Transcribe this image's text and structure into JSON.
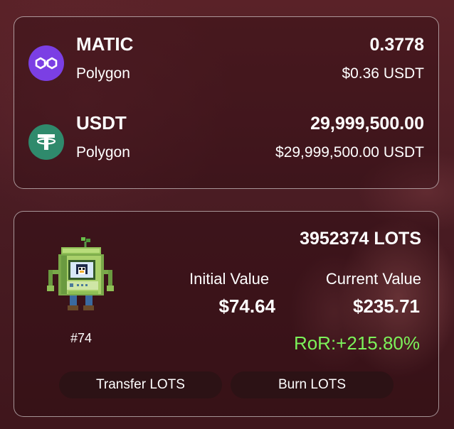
{
  "tokens": [
    {
      "symbol": "MATIC",
      "network": "Polygon",
      "balance": "0.3778",
      "usd": "$0.36 USDT",
      "icon": "polygon-icon",
      "color": "#7b3fe4"
    },
    {
      "symbol": "USDT",
      "network": "Polygon",
      "balance": "29,999,500.00",
      "usd": "$29,999,500.00 USDT",
      "icon": "tether-icon",
      "color": "#2f8a6c"
    }
  ],
  "nft": {
    "id": "#74",
    "amount": "3952374 LOTS",
    "initial_label": "Initial Value",
    "initial_value": "$74.64",
    "current_label": "Current Value",
    "current_value": "$235.71",
    "ror": "RoR:+215.80%",
    "ror_color": "#7cf25a"
  },
  "actions": {
    "transfer_label": "Transfer LOTS",
    "burn_label": "Burn LOTS"
  }
}
